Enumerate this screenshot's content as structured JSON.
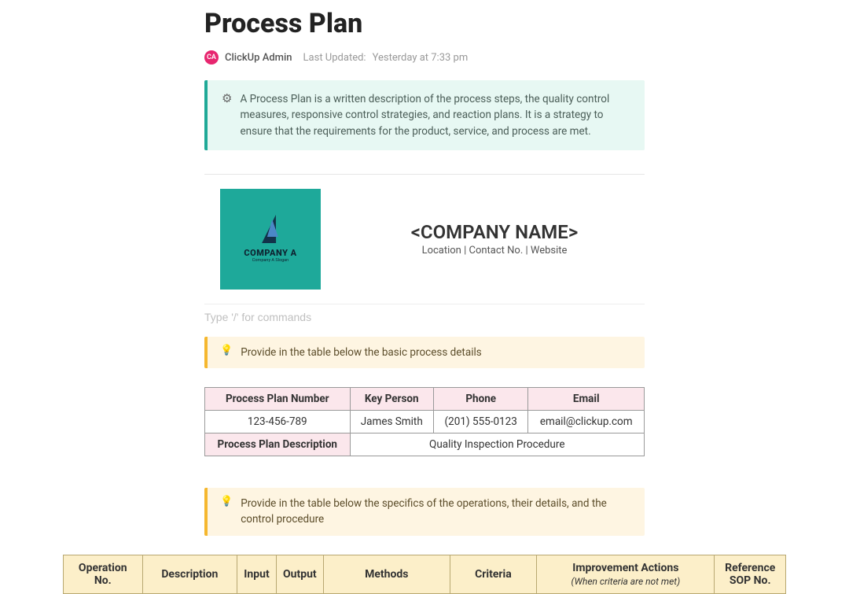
{
  "title": "Process Plan",
  "meta": {
    "avatar_initials": "CA",
    "author": "ClickUp Admin",
    "updated_label": "Last Updated:",
    "updated_time": "Yesterday at 7:33 pm"
  },
  "callout": {
    "text": "A Process Plan is a written description of the process steps, the quality control measures, responsive control strategies, and reaction plans. It is a strategy to ensure that the requirements for the product, service, and process are met."
  },
  "logo": {
    "name": "COMPANY A",
    "slogan": "Company A Slogan"
  },
  "company": {
    "placeholder": "<COMPANY NAME>",
    "subline": "Location | Contact No. | Website"
  },
  "slash": {
    "placeholder": "Type '/' for commands"
  },
  "note1": {
    "text": "Provide in the table below the basic process details"
  },
  "details": {
    "headers": {
      "plan_number": "Process Plan Number",
      "key_person": "Key Person",
      "phone": "Phone",
      "email": "Email"
    },
    "values": {
      "plan_number": "123-456-789",
      "key_person": "James Smith",
      "phone": "(201) 555-0123",
      "email": "email@clickup.com"
    },
    "desc_label": "Process Plan Description",
    "desc_value": "Quality Inspection Procedure"
  },
  "note2": {
    "text": "Provide in the table below the specifics of the operations, their details, and the control procedure"
  },
  "ops_headers": {
    "op_no": "Operation No.",
    "description": "Description",
    "input": "Input",
    "output": "Output",
    "methods": "Methods",
    "criteria": "Criteria",
    "improvement": "Improvement Actions",
    "improvement_sub": "(When criteria are not met)",
    "reference": "Reference SOP No."
  }
}
